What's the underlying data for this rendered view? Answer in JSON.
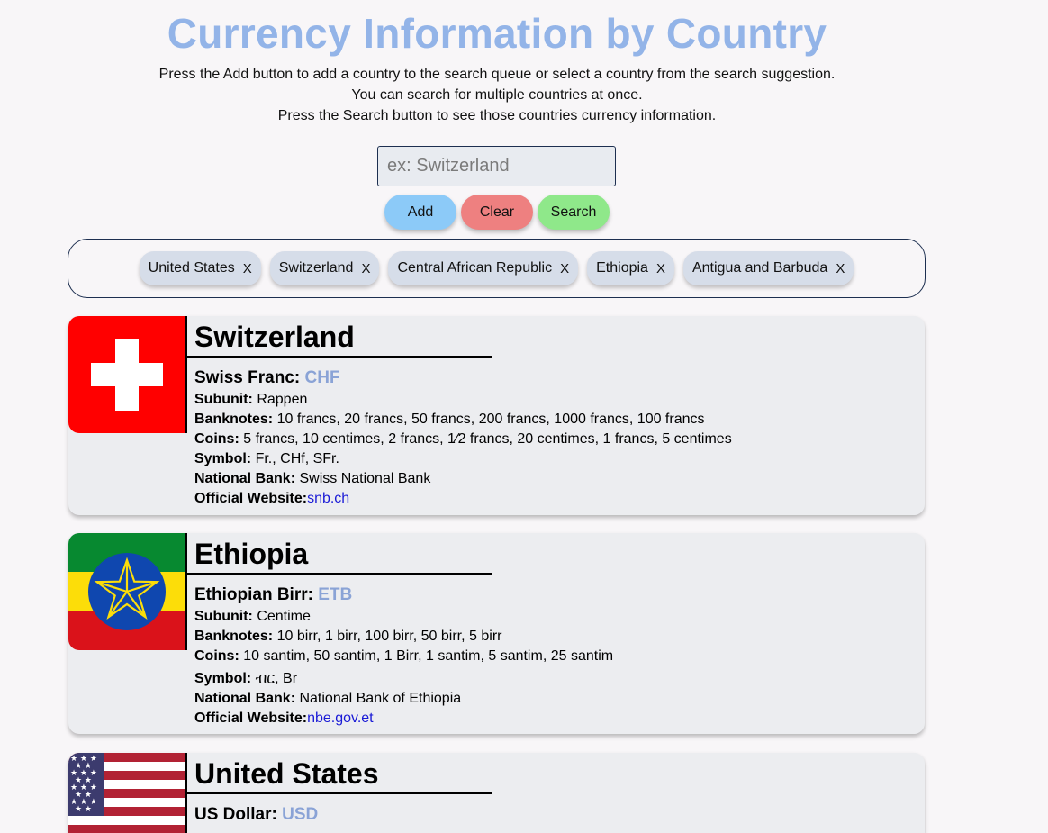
{
  "page": {
    "title": "Currency Information by Country",
    "instructions": [
      "Press the Add button to add a country to the search queue or select a country from the search suggestion.",
      "You can search for multiple countries at once.",
      "Press the Search button to see those countries currency information."
    ]
  },
  "search": {
    "placeholder": "ex: Switzerland",
    "value": ""
  },
  "buttons": {
    "add": "Add",
    "clear": "Clear",
    "search": "Search"
  },
  "queue": [
    {
      "label": "United States",
      "remove": "X"
    },
    {
      "label": "Switzerland",
      "remove": "X"
    },
    {
      "label": "Central African Republic",
      "remove": "X"
    },
    {
      "label": "Ethiopia",
      "remove": "X"
    },
    {
      "label": "Antigua and Barbuda",
      "remove": "X"
    }
  ],
  "field_labels": {
    "subunit": "Subunit:",
    "banknotes": "Banknotes:",
    "coins": "Coins:",
    "symbol": "Symbol:",
    "bank": "National Bank:",
    "website": "Official Website:"
  },
  "cards": [
    {
      "country": "Switzerland",
      "flag": "switzerland-flag",
      "currency_name": "Swiss Franc:",
      "currency_code": "CHF",
      "subunit": "Rappen",
      "banknotes": "10 francs, 20 francs, 50 francs, 200 francs, 1000 francs, 100 francs",
      "coins": "5 francs, 10 centimes, 2 francs, 1⁄2 francs, 20 centimes, 1 francs, 5 centimes",
      "symbol": "Fr., CHf, SFr.",
      "bank": "Swiss National Bank",
      "website": "snb.ch"
    },
    {
      "country": "Ethiopia",
      "flag": "ethiopia-flag",
      "currency_name": "Ethiopian Birr:",
      "currency_code": "ETB",
      "subunit": "Centime",
      "banknotes": "10 birr, 1 birr, 100 birr, 50 birr, 5 birr",
      "coins": "10 santim, 50 santim, 1 Birr, 1 santim, 5 santim, 25 santim",
      "symbol": "ብር, Br",
      "bank": "National Bank of Ethiopia",
      "website": "nbe.gov.et"
    },
    {
      "country": "United States",
      "flag": "united-states-flag",
      "currency_name": "US Dollar:",
      "currency_code": "USD"
    }
  ],
  "colors": {
    "title": "#93b4e8",
    "add_button": "#8ccaf8",
    "clear_button": "#ee8080",
    "search_button": "#8fe88a",
    "currency_code": "#8aa3d6",
    "link": "#1a1ad6"
  }
}
